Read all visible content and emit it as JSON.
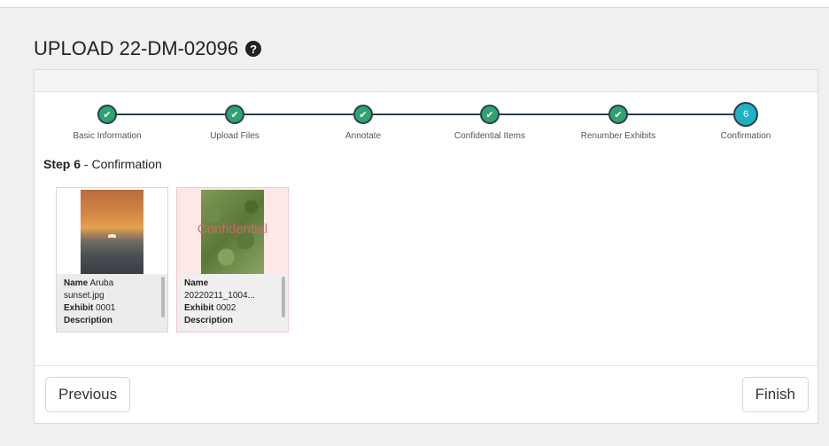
{
  "page": {
    "title": "UPLOAD 22-DM-02096",
    "help_icon": "question-circle-icon"
  },
  "stepper": {
    "steps": [
      {
        "label": "Basic Information",
        "state": "done",
        "icon": "check-icon"
      },
      {
        "label": "Upload Files",
        "state": "done",
        "icon": "check-icon"
      },
      {
        "label": "Annotate",
        "state": "done",
        "icon": "check-icon"
      },
      {
        "label": "Confidential Items",
        "state": "done",
        "icon": "check-icon"
      },
      {
        "label": "Renumber Exhibits",
        "state": "done",
        "icon": "check-icon"
      },
      {
        "label": "Confirmation",
        "state": "current",
        "number": "6"
      }
    ],
    "colors": {
      "done": "#2ea36f",
      "current": "#1fb1c4",
      "line": "#2b3e4c"
    }
  },
  "step_heading": {
    "prefix": "Step 6",
    "suffix": " - Confirmation"
  },
  "files": [
    {
      "name_label": "Name",
      "name_value": " Aruba",
      "name_value_2": "sunset.jpg",
      "exhibit_label": "Exhibit",
      "exhibit_value": " 0001",
      "description_label": "Description",
      "confidential": false
    },
    {
      "name_label": "Name",
      "name_value": "",
      "name_value_2": "20220211_1004...",
      "exhibit_label": "Exhibit",
      "exhibit_value": " 0002",
      "description_label": "Description",
      "confidential": true,
      "watermark": "Confidential"
    }
  ],
  "footer": {
    "previous_label": "Previous",
    "finish_label": "Finish"
  }
}
